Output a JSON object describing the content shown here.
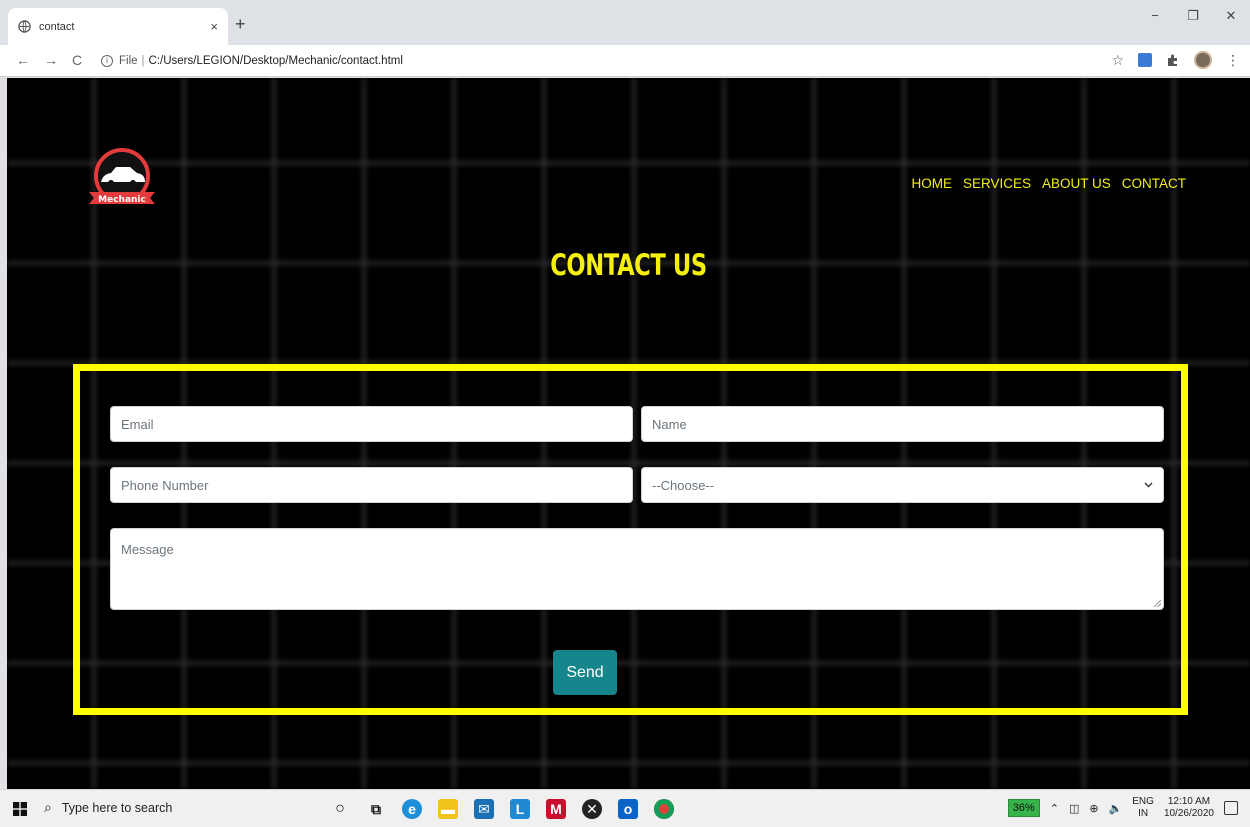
{
  "browser": {
    "tab_title": "contact",
    "tab_close": "×",
    "new_tab": "+",
    "window_controls": [
      "−",
      "❐",
      "✕"
    ],
    "nav": {
      "back": "←",
      "forward": "→",
      "reload": "C"
    },
    "url_scheme": "File",
    "url_separator": "|",
    "url": "C:/Users/LEGION/Desktop/Mechanic/contact.html",
    "menu": "⋮",
    "star": "☆"
  },
  "page": {
    "logo_text": "Mechanic",
    "nav": [
      "HOME",
      "SERVICES",
      "ABOUT US",
      "CONTACT"
    ],
    "heading": "CONTACT US",
    "form": {
      "email_placeholder": "Email",
      "name_placeholder": "Name",
      "phone_placeholder": "Phone Number",
      "choose_value": "--Choose--",
      "message_placeholder": "Message",
      "send_label": "Send"
    },
    "colors": {
      "accent_yellow": "#ffff00",
      "nav_yellow": "#f2ee1e",
      "button_teal": "#17858c",
      "logo_red": "#e33b3b"
    }
  },
  "taskbar": {
    "search_placeholder": "Type here to search",
    "battery": "36%",
    "lang_top": "ENG",
    "lang_bottom": "IN",
    "time": "12:10 AM",
    "date": "10/26/2020"
  }
}
